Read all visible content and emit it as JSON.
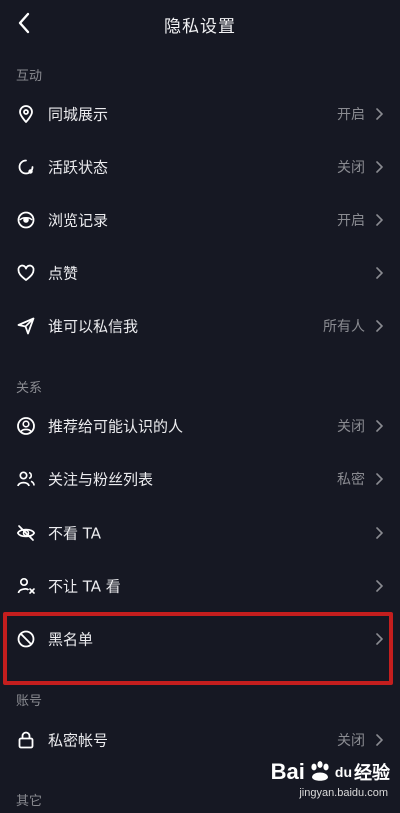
{
  "header": {
    "back_icon": "chevron-left-icon",
    "title": "隐私设置"
  },
  "sections": {
    "interaction": {
      "title": "互动",
      "items": [
        {
          "icon": "location-pin-icon",
          "label": "同城展示",
          "value": "开启"
        },
        {
          "icon": "activity-status-icon",
          "label": "活跃状态",
          "value": "关闭"
        },
        {
          "icon": "eye-icon",
          "label": "浏览记录",
          "value": "开启"
        },
        {
          "icon": "heart-icon",
          "label": "点赞",
          "value": ""
        },
        {
          "icon": "send-icon",
          "label": "谁可以私信我",
          "value": "所有人"
        }
      ]
    },
    "relations": {
      "title": "关系",
      "items": [
        {
          "icon": "user-circle-icon",
          "label": "推荐给可能认识的人",
          "value": "关闭"
        },
        {
          "icon": "users-icon",
          "label": "关注与粉丝列表",
          "value": "私密"
        },
        {
          "icon": "eye-off-icon",
          "label": "不看 TA",
          "value": ""
        },
        {
          "icon": "user-hide-icon",
          "label": "不让 TA 看",
          "value": ""
        },
        {
          "icon": "block-icon",
          "label": "黑名单",
          "value": ""
        }
      ]
    },
    "account": {
      "title": "账号",
      "items": [
        {
          "icon": "lock-icon",
          "label": "私密帐号",
          "value": "关闭"
        }
      ]
    },
    "other": {
      "title": "其它"
    }
  },
  "highlight_color": "#c41e1e",
  "watermark": {
    "brand_left": "Bai",
    "brand_mid": "du",
    "brand_cn": "经验",
    "url": "jingyan.baidu.com"
  }
}
